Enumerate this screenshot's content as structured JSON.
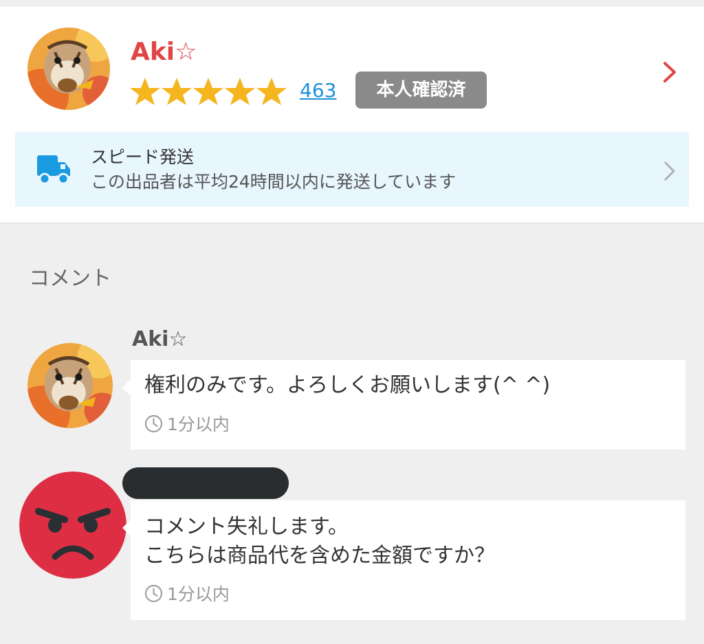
{
  "seller": {
    "name": "Aki☆",
    "rating_stars": 5,
    "rating_count": "463",
    "verified_label": "本人確認済",
    "avatar_icon": "chipmunk-avatar-icon"
  },
  "speed_shipping": {
    "title": "スピード発送",
    "description": "この出品者は平均24時間以内に発送しています",
    "icon": "truck-icon"
  },
  "comments_section": {
    "title": "コメント",
    "comments": [
      {
        "author": "Aki☆",
        "text": "権利のみです。よろしくお願いします(^ ^)",
        "time": "1分以内",
        "avatar_icon": "chipmunk-avatar-icon"
      },
      {
        "author": "",
        "author_redacted": true,
        "text": "コメント失礼します。\nこちらは商品代を含めた金額ですか？",
        "time": "1分以内",
        "avatar_icon": "angry-face-icon"
      }
    ]
  },
  "colors": {
    "accent_red": "#e04646",
    "star_yellow": "#f5b51f",
    "link_blue": "#1e90d6",
    "badge_gray": "#8a8a8a",
    "speed_bg": "#e8f6fe",
    "truck_blue": "#1a9ae0",
    "angry_red": "#dd2e44"
  }
}
